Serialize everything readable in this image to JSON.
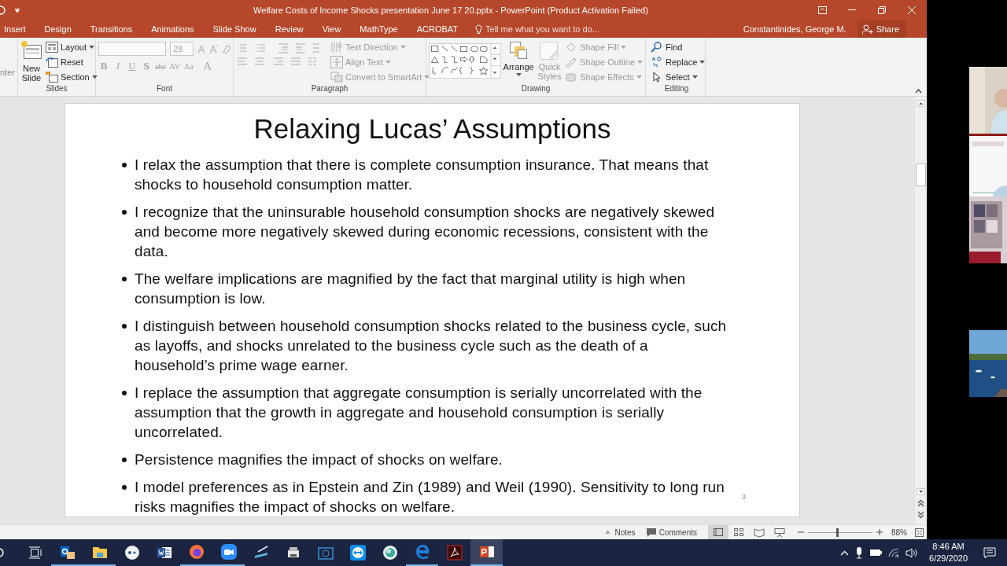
{
  "window": {
    "title": "Welfare Costs of Income Shocks presentation June 17 20.pptx - PowerPoint (Product Activation Failed)",
    "account": "Constantinides, George M.",
    "share": "Share"
  },
  "tabs": [
    {
      "label": "Insert"
    },
    {
      "label": "Design"
    },
    {
      "label": "Transitions"
    },
    {
      "label": "Animations"
    },
    {
      "label": "Slide Show"
    },
    {
      "label": "Review"
    },
    {
      "label": "View"
    },
    {
      "label": "MathType"
    },
    {
      "label": "ACROBAT"
    }
  ],
  "tell_me": {
    "placeholder": "Tell me what you want to do..."
  },
  "ribbon": {
    "clipped_label": "nter",
    "slides": {
      "label": "Slides",
      "new_slide": {
        "label": "New Slide",
        "disabled": false
      },
      "commands": [
        {
          "kind": "layout",
          "label": "Layout",
          "dropdown": true,
          "disabled": false
        },
        {
          "kind": "reset",
          "label": "Reset",
          "dropdown": false,
          "disabled": false
        },
        {
          "kind": "section",
          "label": "Section",
          "dropdown": true,
          "disabled": false
        }
      ]
    },
    "font": {
      "label": "Font",
      "font_size": "28",
      "disabled": true,
      "format_buttons": [
        "B",
        "I",
        "U",
        "S",
        "abc",
        "AV",
        "Aa",
        "A"
      ]
    },
    "paragraph": {
      "label": "Paragraph",
      "commands": [
        {
          "kind": "text-direction",
          "label": "Text Direction",
          "dropdown": true,
          "disabled": true
        },
        {
          "kind": "align-text",
          "label": "Align Text",
          "dropdown": true,
          "disabled": true
        },
        {
          "kind": "smartart",
          "label": "Convert to SmartArt",
          "dropdown": true,
          "disabled": true
        }
      ]
    },
    "drawing": {
      "label": "Drawing",
      "arrange": {
        "label": "Arrange",
        "disabled": false
      },
      "quick_styles": {
        "label": "Quick Styles",
        "disabled": true
      },
      "commands": [
        {
          "kind": "fill",
          "label": "Shape Fill",
          "dropdown": true,
          "disabled": true
        },
        {
          "kind": "outline",
          "label": "Shape Outline",
          "dropdown": true,
          "disabled": true
        },
        {
          "kind": "effects",
          "label": "Shape Effects",
          "dropdown": true,
          "disabled": true
        }
      ]
    },
    "editing": {
      "label": "Editing",
      "commands": [
        {
          "kind": "find",
          "label": "Find",
          "dropdown": false,
          "disabled": false
        },
        {
          "kind": "replace",
          "label": "Replace",
          "dropdown": true,
          "disabled": false
        },
        {
          "kind": "select",
          "label": "Select",
          "dropdown": true,
          "disabled": false
        }
      ]
    }
  },
  "slide": {
    "title": "Relaxing Lucas’ Assumptions",
    "slide_number": "3",
    "bullets": [
      "I relax the assumption that there is complete consumption insurance. That means that shocks to household consumption matter.",
      "I recognize that the uninsurable household consumption shocks are negatively skewed and become more negatively skewed during economic recessions, consistent with the data.",
      "The welfare implications are magnified by the fact that marginal utility is high when consumption is low.",
      "I distinguish between household consumption shocks related to the business cycle, such as layoffs, and shocks unrelated to the business cycle such as the death of a household’s prime wage earner.",
      "I replace the assumption that aggregate consumption is serially uncorrelated with the assumption that the growth in aggregate and household consumption is serially uncorrelated.",
      "Persistence magnifies the impact of shocks on welfare.",
      "I model preferences as in Epstein and Zin (1989) and Weil (1990).  Sensitivity to long run risks magnifies the impact of shocks on welfare."
    ]
  },
  "status_bar": {
    "notes": "Notes",
    "comments": "Comments",
    "views": [
      {
        "kind": "normal",
        "selected": true
      },
      {
        "kind": "sorter",
        "selected": false
      },
      {
        "kind": "reading",
        "selected": false
      },
      {
        "kind": "show",
        "selected": false
      }
    ],
    "zoom": {
      "level": 0.45,
      "reading": "88%"
    }
  },
  "taskbar": {
    "apps": [
      {
        "kind": "outlook",
        "running": true,
        "active": false
      },
      {
        "kind": "explorer",
        "running": true,
        "active": false
      },
      {
        "kind": "dots",
        "running": false,
        "active": false
      },
      {
        "kind": "word",
        "running": false,
        "active": false
      },
      {
        "kind": "firefox",
        "running": true,
        "active": false
      },
      {
        "kind": "zoom",
        "running": true,
        "active": false
      },
      {
        "kind": "scanner",
        "running": false,
        "active": false
      },
      {
        "kind": "printer",
        "running": false,
        "active": false
      },
      {
        "kind": "hp",
        "running": false,
        "active": false
      },
      {
        "kind": "teamviewer",
        "running": false,
        "active": false
      },
      {
        "kind": "globe",
        "running": false,
        "active": false
      },
      {
        "kind": "edge",
        "running": true,
        "active": false
      },
      {
        "kind": "acrobat",
        "running": false,
        "active": false
      },
      {
        "kind": "powerpoint",
        "running": true,
        "active": true
      }
    ],
    "time": "8:46 AM",
    "date": "6/29/2020"
  }
}
